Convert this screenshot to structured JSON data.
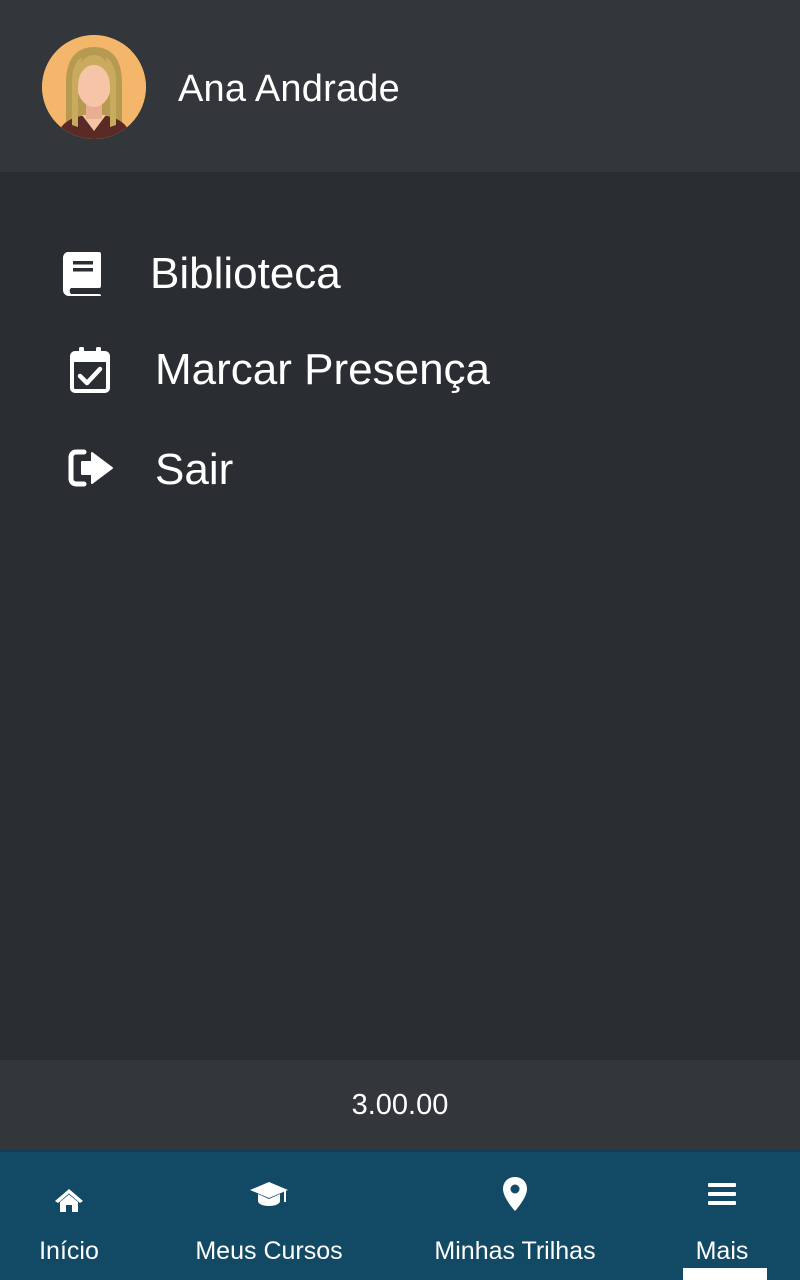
{
  "header": {
    "user_name": "Ana Andrade",
    "avatar_icon": "user-avatar-woman"
  },
  "menu": {
    "items": [
      {
        "label": "Biblioteca",
        "icon": "book-icon"
      },
      {
        "label": "Marcar Presença",
        "icon": "calendar-check-icon"
      },
      {
        "label": "Sair",
        "icon": "sign-out-icon"
      }
    ]
  },
  "footer": {
    "version": "3.00.00"
  },
  "bottom_nav": {
    "items": [
      {
        "label": "Início",
        "icon": "home-icon"
      },
      {
        "label": "Meus Cursos",
        "icon": "graduation-cap-icon"
      },
      {
        "label": "Minhas Trilhas",
        "icon": "map-marker-icon"
      },
      {
        "label": "Mais",
        "icon": "menu-icon",
        "active": true
      }
    ]
  },
  "colors": {
    "background": "#2a2d31",
    "header_background": "#33363a",
    "nav_background": "#124a66",
    "avatar_background": "#f4b66a",
    "text": "#ffffff"
  }
}
